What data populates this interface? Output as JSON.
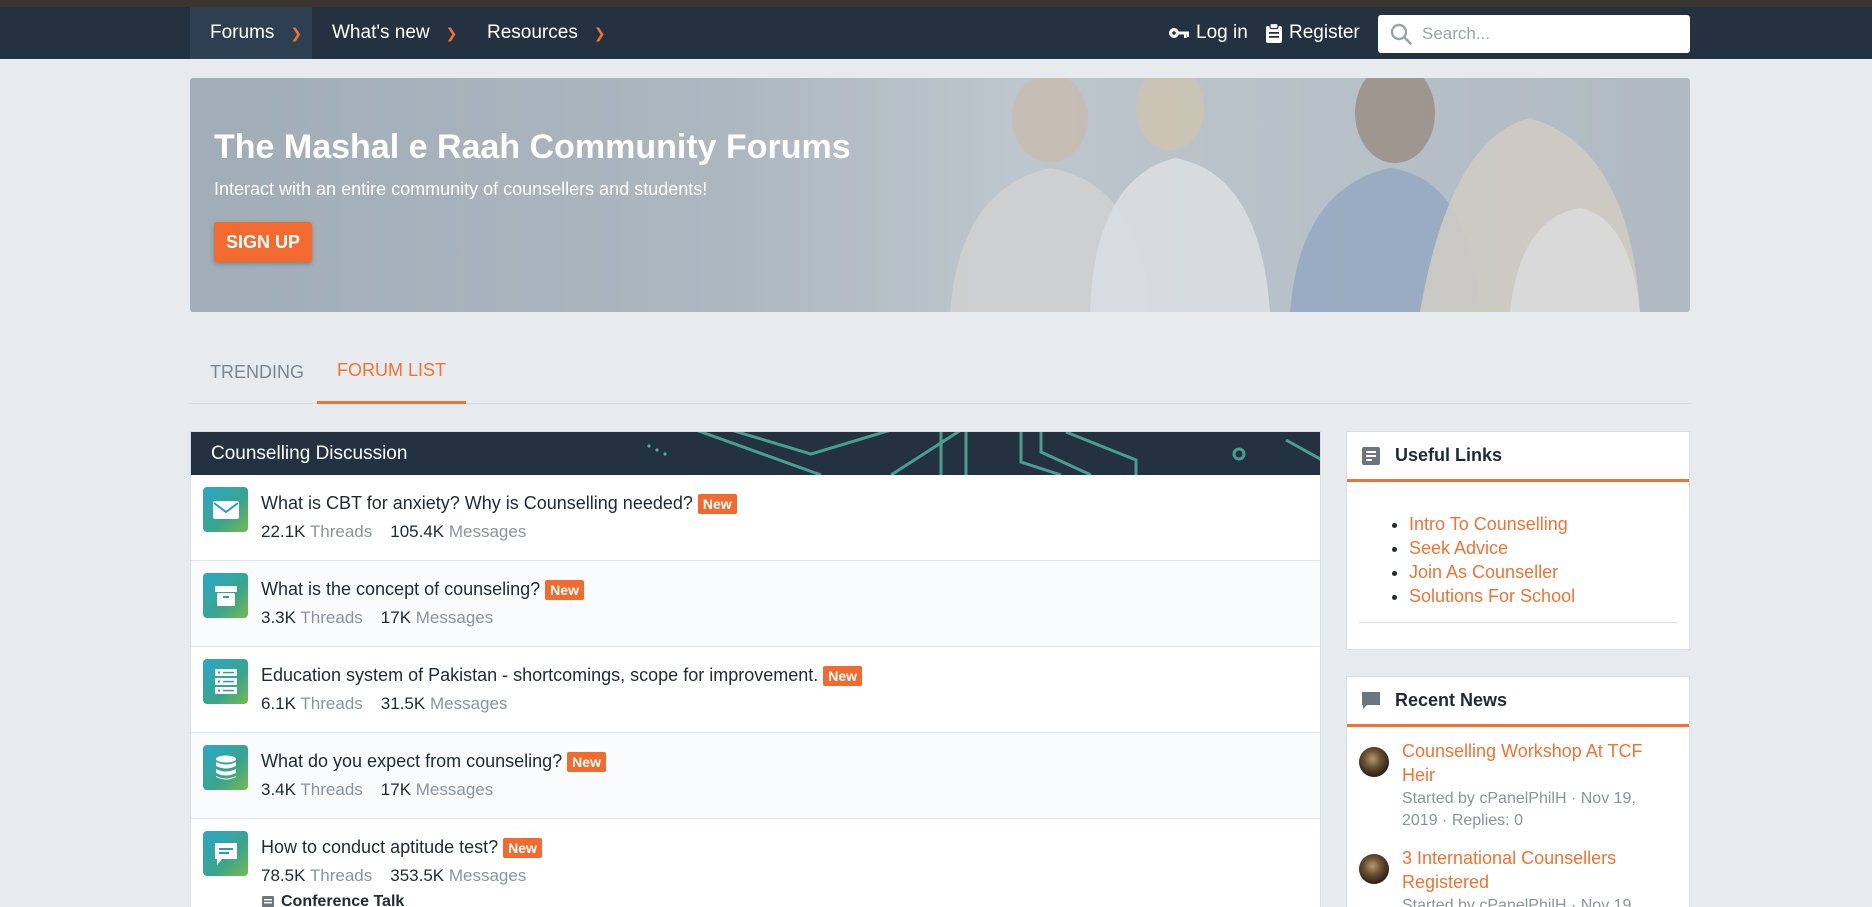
{
  "nav": {
    "items": [
      {
        "label": "Forums",
        "active": true
      },
      {
        "label": "What's new",
        "active": false
      },
      {
        "label": "Resources",
        "active": false
      }
    ],
    "login_label": "Log in",
    "register_label": "Register",
    "search_placeholder": "Search..."
  },
  "banner": {
    "title": "The Mashal e Raah Community Forums",
    "subtitle": "Interact with an entire community of counsellers and students!",
    "signup_label": "SIGN UP"
  },
  "tabs": [
    {
      "label": "TRENDING",
      "active": false
    },
    {
      "label": "FORUM LIST",
      "active": true
    }
  ],
  "forum": {
    "category_title": "Counselling Discussion",
    "threads_label": "Threads",
    "messages_label": "Messages",
    "new_badge": "New",
    "nodes": [
      {
        "title": "What is CBT for anxiety? Why is Counselling needed?",
        "threads": "22.1K",
        "messages": "105.4K",
        "icon": "envelope-icon"
      },
      {
        "title": "What is the concept of counseling?",
        "threads": "3.3K",
        "messages": "17K",
        "icon": "archive-icon"
      },
      {
        "title": "Education system of Pakistan - shortcomings, scope for improvement.",
        "threads": "6.1K",
        "messages": "31.5K",
        "icon": "server-icon"
      },
      {
        "title": "What do you expect from counseling?",
        "threads": "3.4K",
        "messages": "17K",
        "icon": "database-icon"
      },
      {
        "title": "How to conduct aptitude test?",
        "threads": "78.5K",
        "messages": "353.5K",
        "icon": "comment-icon"
      }
    ],
    "sub_node_label": "Conference Talk"
  },
  "useful_links": {
    "title": "Useful Links",
    "items": [
      "Intro To Counselling",
      "Seek Advice",
      "Join As Counseller",
      "Solutions For School"
    ]
  },
  "recent_news": {
    "title": "Recent News",
    "items": [
      {
        "title": "Counselling Workshop At TCF Heir",
        "meta": "Started by cPanelPhilH · Nov 19, 2019 · Replies: 0"
      },
      {
        "title": "3 International Counsellers Registered",
        "meta": "Started by cPanelPhilH · Nov 19"
      }
    ]
  },
  "colors": {
    "nav_bg": "#233140",
    "accent": "#f07234",
    "page_bg": "#e8ebee"
  }
}
